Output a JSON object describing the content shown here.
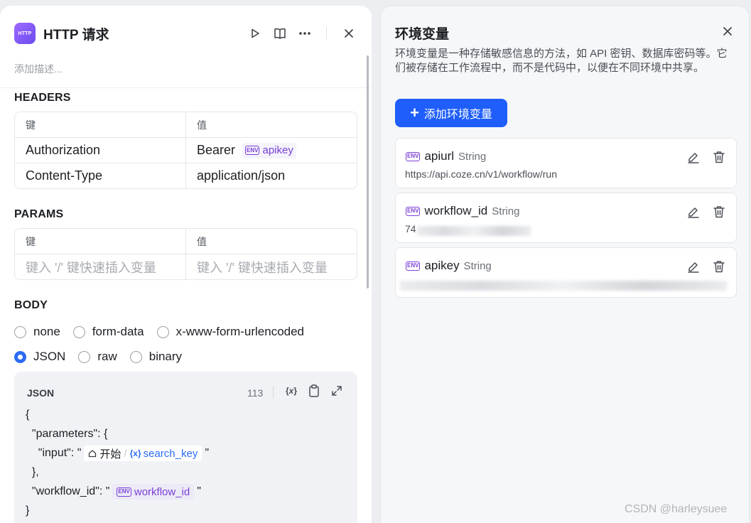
{
  "node": {
    "icon_text": "HTTP",
    "title": "HTTP 请求",
    "description_placeholder": "添加描述..."
  },
  "headers": {
    "title": "HEADERS",
    "key_col": "键",
    "value_col": "值",
    "rows": [
      {
        "key": "Authorization",
        "value_prefix": "Bearer",
        "value_var": "apikey"
      },
      {
        "key": "Content-Type",
        "value": "application/json"
      }
    ]
  },
  "params": {
    "title": "PARAMS",
    "key_col": "键",
    "value_col": "值",
    "key_placeholder": "键入 '/' 键快速插入变量",
    "value_placeholder": "键入 '/' 键快速插入变量"
  },
  "body": {
    "title": "BODY",
    "options": [
      "none",
      "form-data",
      "x-www-form-urlencoded",
      "JSON",
      "raw",
      "binary"
    ],
    "selected": "JSON",
    "editor": {
      "label": "JSON",
      "count": "113",
      "lines": {
        "l1": "{",
        "l2": "  \"parameters\": {",
        "l3_prefix": "    \"input\": \"",
        "l3_node": "开始",
        "l3_var": "search_key",
        "l3_suffix": "\"",
        "l4": "  },",
        "l5_prefix": "  \"workflow_id\": \"",
        "l5_var": "workflow_id",
        "l5_suffix": "\"",
        "l6": "}"
      }
    }
  },
  "env_panel": {
    "title": "环境变量",
    "description": "环境变量是一种存储敏感信息的方法，如 API 密钥、数据库密码等。它们被存储在工作流程中，而不是代码中，以便在不同环境中共享。",
    "add_button": "添加环境变量",
    "variables": [
      {
        "name": "apiurl",
        "type": "String",
        "value": "https://api.coze.cn/v1/workflow/run"
      },
      {
        "name": "workflow_id",
        "type": "String",
        "value": "74"
      },
      {
        "name": "apikey",
        "type": "String",
        "value": ""
      }
    ]
  },
  "watermark": "CSDN @harleysuee",
  "colors": {
    "accent": "#1f5efa",
    "env_purple": "#7a3fd9",
    "var_blue": "#2b6bf5"
  }
}
